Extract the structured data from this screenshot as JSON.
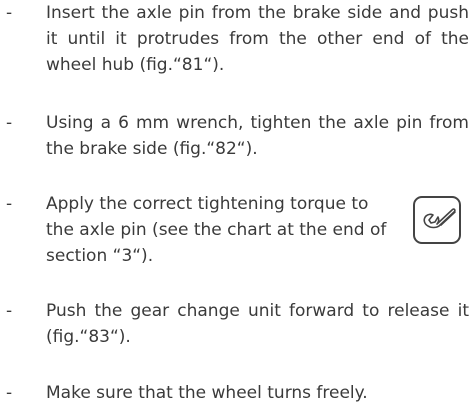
{
  "instructions": [
    {
      "bullet": "-",
      "text": "Insert the axle pin from the brake side and push it until it protrudes from the other end of the wheel hub (fig.“81“)."
    },
    {
      "bullet": "-",
      "text": "Using a 6 mm wrench, tighten the axle pin from the brake side (fig.“82“)."
    },
    {
      "bullet": "-",
      "text": "Apply the correct tightening torque to the axle pin (see the chart at the end of section “3“).",
      "icon": "torque-wrench-icon"
    },
    {
      "bullet": "-",
      "text": "Push the gear change unit forward to release it (fig.“83“)."
    },
    {
      "bullet": "-",
      "text": "Make sure that the wheel turns freely."
    }
  ]
}
